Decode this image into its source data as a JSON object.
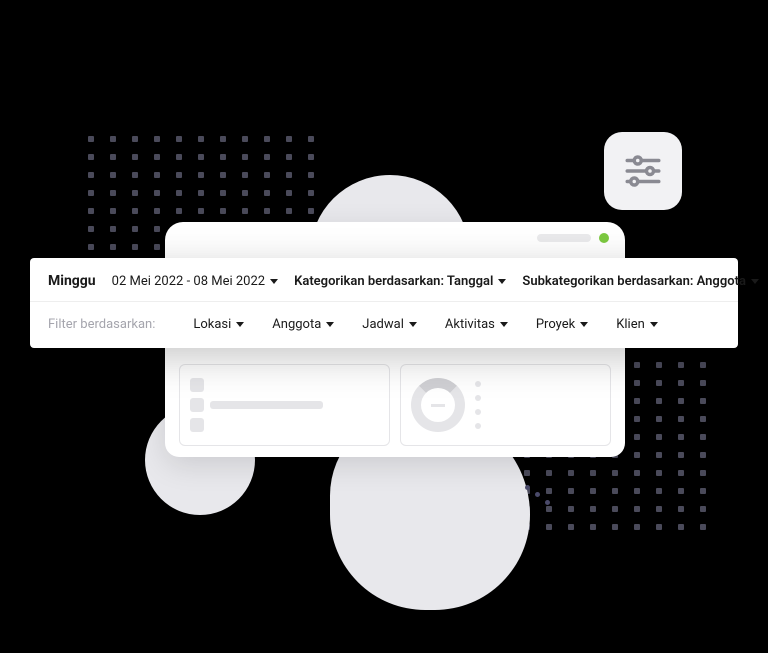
{
  "period": {
    "label": "Minggu",
    "range": "02 Mei 2022 - 08 Mei 2022"
  },
  "categorize": {
    "prefix": "Kategorikan berdasarkan:",
    "value": "Tanggal"
  },
  "subcategorize": {
    "prefix": "Subkategorikan berdasarkan:",
    "value": "Anggota"
  },
  "filter_by_label": "Filter berdasarkan:",
  "filters": {
    "location": "Lokasi",
    "member": "Anggota",
    "schedule": "Jadwal",
    "activity": "Aktivitas",
    "project": "Proyek",
    "client": "Klien"
  }
}
